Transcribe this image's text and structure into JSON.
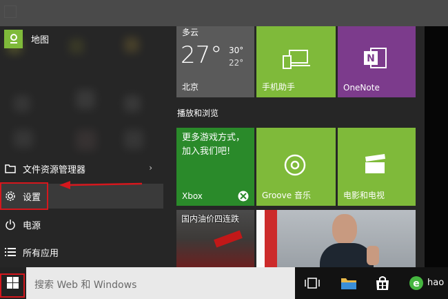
{
  "start_menu": {
    "items": [
      {
        "label": "地图",
        "icon": "maps-icon"
      },
      {
        "label": "文件资源管理器",
        "icon": "file-explorer-icon",
        "has_submenu": true
      },
      {
        "label": "设置",
        "icon": "gear-icon"
      },
      {
        "label": "电源",
        "icon": "power-icon"
      },
      {
        "label": "所有应用",
        "icon": "all-apps-icon"
      }
    ]
  },
  "tiles": {
    "weather": {
      "condition": "多云",
      "temp": "27°",
      "high": "30°",
      "low": "22°",
      "city": "北京"
    },
    "phone_companion": {
      "label": "手机助手",
      "icon": "phone-laptop-icon"
    },
    "onenote": {
      "label": "OneNote",
      "icon": "onenote-icon"
    },
    "group_label": "播放和浏览",
    "xbox": {
      "promo": "更多游戏方式，加入我们吧!",
      "label": "Xbox",
      "icon": "xbox-icon"
    },
    "groove": {
      "label": "Groove 音乐",
      "icon": "groove-icon"
    },
    "movies": {
      "label": "电影和电视",
      "icon": "clapperboard-icon"
    },
    "news": {
      "headline": "国内油价四连跌"
    }
  },
  "taskbar": {
    "search_placeholder": "搜索 Web 和 Windows",
    "pinned_partial_label": "hao"
  },
  "colors": {
    "green": "#7fba3a",
    "purple": "#7c3b8c",
    "red_highlight": "#d6171d",
    "weather_gray": "#5a5a5a"
  }
}
